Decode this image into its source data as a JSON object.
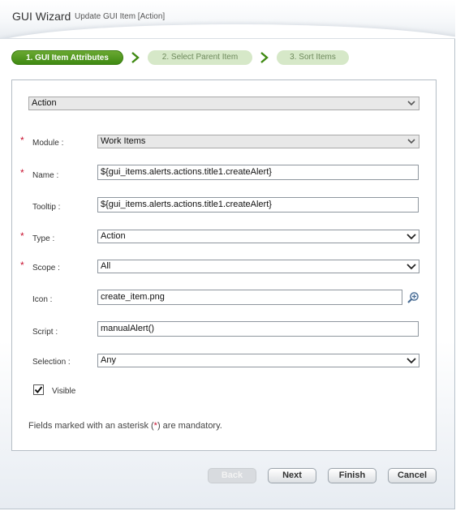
{
  "header": {
    "title": "GUI Wizard",
    "subtitle": "Update GUI Item [Action]"
  },
  "steps": [
    {
      "label": "1. GUI Item Attributes",
      "active": true
    },
    {
      "label": "2. Select Parent Item",
      "active": false
    },
    {
      "label": "3. Sort Items",
      "active": false
    }
  ],
  "form": {
    "item_type_select": "Action",
    "module": {
      "label": "Module :",
      "value": "Work Items",
      "required": true
    },
    "name": {
      "label": "Name :",
      "value": "${gui_items.alerts.actions.title1.createAlert}",
      "required": true
    },
    "tooltip": {
      "label": "Tooltip :",
      "value": "${gui_items.alerts.actions.title1.createAlert}",
      "required": false
    },
    "type": {
      "label": "Type :",
      "value": "Action",
      "required": true
    },
    "scope": {
      "label": "Scope :",
      "value": "All",
      "required": true
    },
    "icon": {
      "label": "Icon :",
      "value": "create_item.png",
      "required": false
    },
    "script": {
      "label": "Script :",
      "value": "manualAlert()",
      "required": false
    },
    "selection": {
      "label": "Selection :",
      "value": "Any",
      "required": false
    },
    "visible": {
      "label": "Visible",
      "checked": true
    },
    "required_marker": "*",
    "mandatory_note_prefix": "Fields marked with an asterisk (",
    "mandatory_note_suffix": ") are mandatory."
  },
  "buttons": {
    "back": "Back",
    "next": "Next",
    "finish": "Finish",
    "cancel": "Cancel"
  },
  "colors": {
    "accent_green": "#3f8a12",
    "step_inactive": "#d6e8c8",
    "required_red": "#c8102e"
  }
}
